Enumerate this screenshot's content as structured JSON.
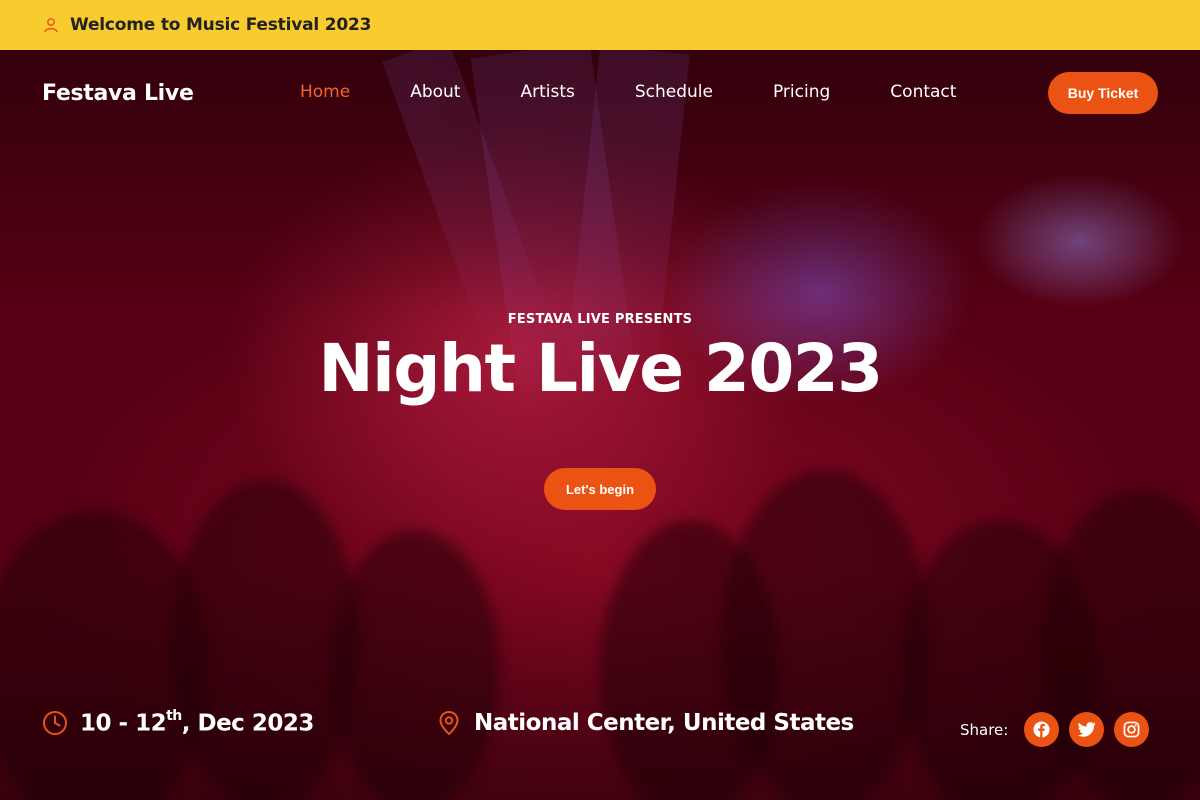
{
  "topbar": {
    "icon": "user-icon",
    "welcome_text": "Welcome to Music Festival 2023"
  },
  "navbar": {
    "brand": "Festava Live",
    "links": [
      {
        "label": "Home",
        "active": true
      },
      {
        "label": "About",
        "active": false
      },
      {
        "label": "Artists",
        "active": false
      },
      {
        "label": "Schedule",
        "active": false
      },
      {
        "label": "Pricing",
        "active": false
      },
      {
        "label": "Contact",
        "active": false
      }
    ],
    "buy_ticket_label": "Buy Ticket"
  },
  "hero": {
    "subtitle": "FESTAVA LIVE PRESENTS",
    "title": "Night Live 2023",
    "cta_label": "Let's begin"
  },
  "event_info": {
    "date_prefix": "10 - 12",
    "date_sup": "th",
    "date_suffix": ", Dec 2023",
    "date_icon": "clock-icon",
    "location": "National Center, United States",
    "location_icon": "map-pin-icon"
  },
  "share": {
    "label": "Share:",
    "icons": [
      "facebook-icon",
      "twitter-icon",
      "instagram-icon"
    ]
  },
  "colors": {
    "topbar_bg": "#f8cb2e",
    "accent": "#ea5313",
    "active_link": "#f0652a",
    "text_light": "#ffffff",
    "text_dark": "#222222"
  }
}
